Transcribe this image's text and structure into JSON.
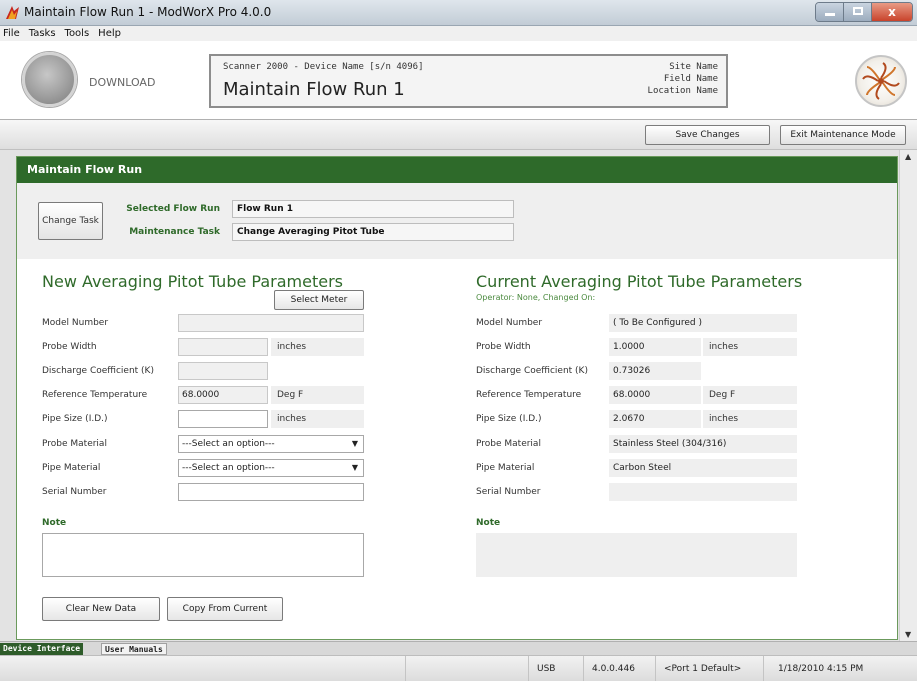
{
  "window": {
    "title": "Maintain Flow Run 1 - ModWorX Pro 4.0.0",
    "close_glyph": "x"
  },
  "menu": {
    "items": [
      "File",
      "Tasks",
      "Tools",
      "Help"
    ]
  },
  "header": {
    "download_label": "DOWNLOAD",
    "device_name": "Scanner 2000 - Device Name [s/n 4096]",
    "screen_title": "Maintain Flow Run 1",
    "site_name": "Site Name",
    "field_name": "Field Name",
    "location_name": "Location Name"
  },
  "toolbar": {
    "save_label": "Save Changes",
    "exit_label": "Exit Maintenance Mode"
  },
  "panel": {
    "title": "Maintain Flow Run",
    "change_task_label": "Change Task",
    "selected_flow_run_label": "Selected Flow Run",
    "selected_flow_run_value": "Flow Run 1",
    "maintenance_task_label": "Maintenance Task",
    "maintenance_task_value": "Change Averaging Pitot Tube"
  },
  "new_params": {
    "title": "New Averaging Pitot Tube Parameters",
    "select_meter_label": "Select Meter",
    "fields": {
      "model_number": "Model Number",
      "probe_width": "Probe Width",
      "discharge_coeff": "Discharge Coefficient (K)",
      "reference_temp": "Reference Temperature",
      "pipe_size": "Pipe Size (I.D.)",
      "probe_material": "Probe Material",
      "pipe_material": "Pipe Material",
      "serial_number": "Serial Number"
    },
    "values": {
      "reference_temp": "68.0000",
      "probe_material": "---Select an option---",
      "pipe_material": "---Select an option---"
    },
    "units": {
      "probe_width": "inches",
      "reference_temp": "Deg F",
      "pipe_size": "inches"
    },
    "note_label": "Note",
    "clear_label": "Clear New Data",
    "copy_label": "Copy From Current"
  },
  "current_params": {
    "title": "Current Averaging Pitot Tube Parameters",
    "operator": "Operator: None, Changed On:",
    "fields": {
      "model_number": "Model Number",
      "probe_width": "Probe Width",
      "discharge_coeff": "Discharge Coefficient (K)",
      "reference_temp": "Reference Temperature",
      "pipe_size": "Pipe Size (I.D.)",
      "probe_material": "Probe Material",
      "pipe_material": "Pipe Material",
      "serial_number": "Serial Number"
    },
    "values": {
      "model_number": "( To Be Configured )",
      "probe_width": "1.0000",
      "discharge_coeff": "0.73026",
      "reference_temp": "68.0000",
      "pipe_size": "2.0670",
      "probe_material": "Stainless Steel (304/316)",
      "pipe_material": "Carbon Steel"
    },
    "units": {
      "probe_width": "inches",
      "reference_temp": "Deg F",
      "pipe_size": "inches"
    },
    "note_label": "Note"
  },
  "tabs": {
    "device_interface": "Device Interface",
    "user_manuals": "User Manuals"
  },
  "status": {
    "connection": "USB",
    "version": "4.0.0.446",
    "port": "<Port 1 Default>",
    "datetime": "1/18/2010 4:15 PM"
  },
  "colors": {
    "accent_green": "#2e6a2a",
    "label_green": "#2f6a2a"
  }
}
